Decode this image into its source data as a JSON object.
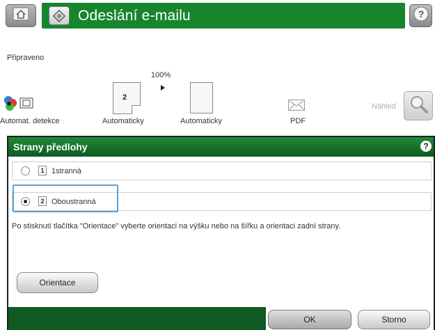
{
  "header": {
    "home_icon": "home-icon",
    "send_icon": "email-send-icon",
    "title": "Odeslání e-mailu",
    "help_icon": "help-icon",
    "accent_color": "#17852e"
  },
  "status": "Připraveno",
  "quick_settings": {
    "zoom": "100%",
    "items": [
      {
        "label": "Automat. detekce",
        "icon": "color-detect-icon"
      },
      {
        "label": "Automaticky",
        "icon": "document-sides-icon",
        "badge": "2"
      },
      {
        "label": "Automaticky",
        "icon": "document-size-icon"
      },
      {
        "label": "PDF",
        "icon": "pdf-envelope-icon"
      }
    ],
    "preview_label": "Náhled",
    "preview_icon": "magnifier-icon"
  },
  "panel": {
    "title": "Strany předlohy",
    "help_icon": "help-icon",
    "options": [
      {
        "badge": "1",
        "label": "1stranná",
        "selected": false
      },
      {
        "badge": "2",
        "label": "Oboustranná",
        "selected": true
      }
    ],
    "info": "Po stisknutí tlačítka \"Orientace\" vyberte orientaci na výšku nebo na šířku a orientaci zadní strany.",
    "orientation_button": "Orientace"
  },
  "footer": {
    "ok": "OK",
    "cancel": "Storno"
  }
}
